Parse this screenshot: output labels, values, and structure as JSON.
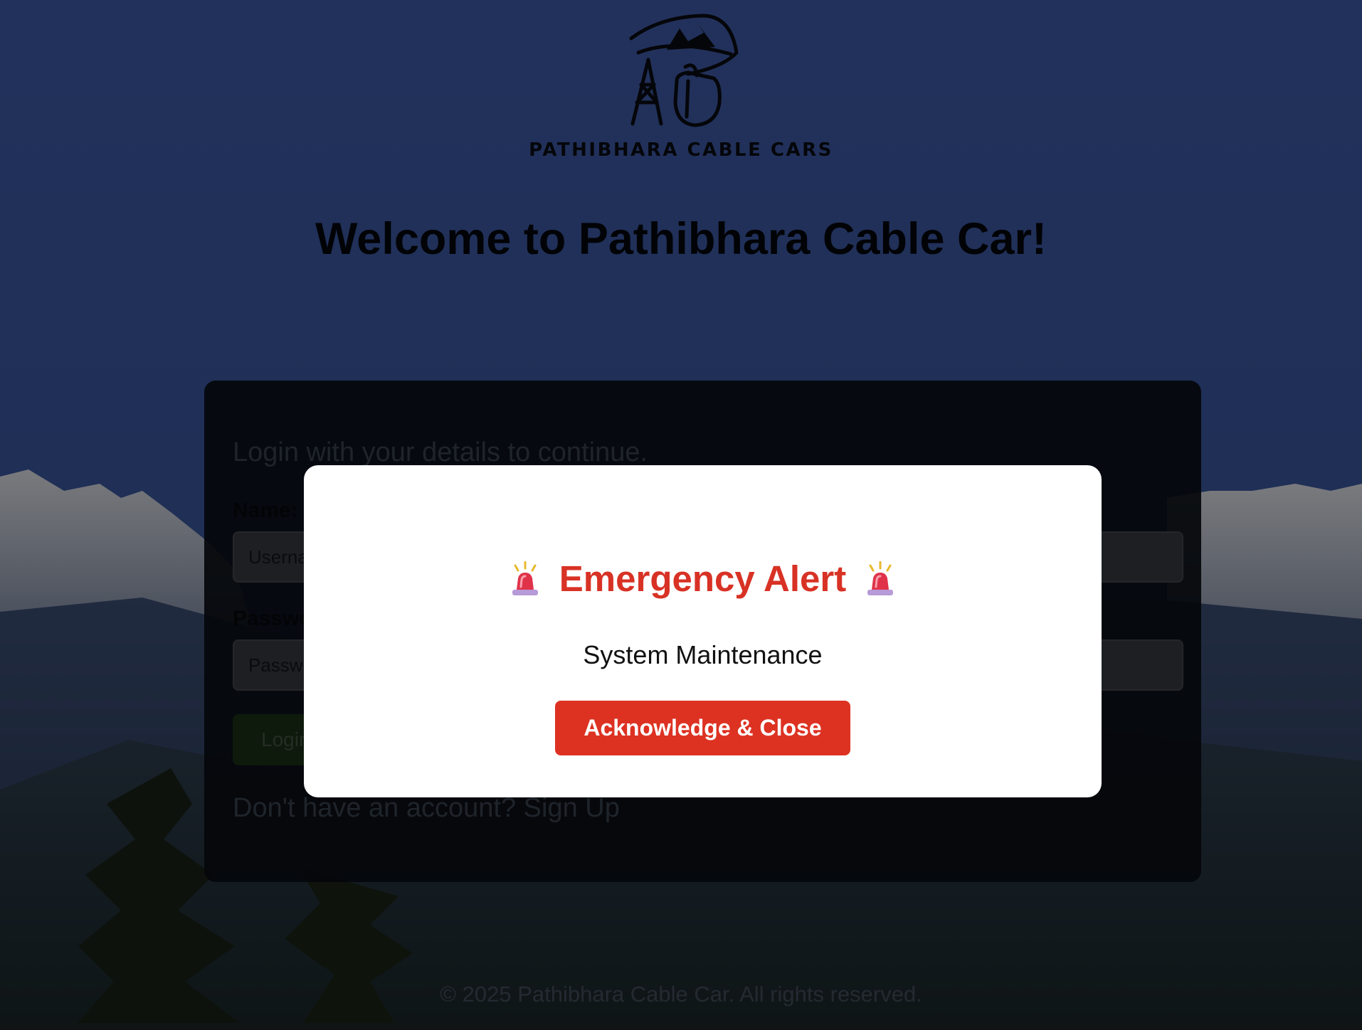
{
  "brand": {
    "logo_text": "PATHIBHARA CABLE CARS",
    "welcome_title": "Welcome to Pathibhara Cable Car!"
  },
  "login_form": {
    "subtitle": "Login with your details to continue.",
    "name_label": "Name:",
    "username_placeholder": "Username",
    "password_label": "Password:",
    "password_placeholder": "Password",
    "login_button": "Login",
    "signup_prompt": "Don't have an account?",
    "signup_link": "Sign Up"
  },
  "modal": {
    "title": "Emergency Alert",
    "message": "System Maintenance",
    "button_label": "Acknowledge & Close",
    "icon": "siren-icon"
  },
  "footer": {
    "copyright": "© 2025 Pathibhara Cable Car. All rights reserved."
  },
  "colors": {
    "sky": "#4563b6",
    "alert_red": "#d83225",
    "button_red": "#dd3222",
    "login_green": "#1c3418"
  }
}
